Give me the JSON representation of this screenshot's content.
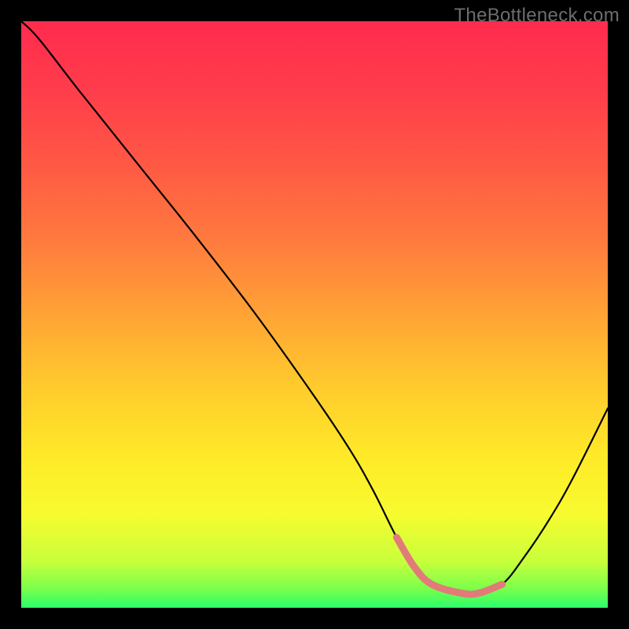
{
  "watermark": "TheBottleneck.com",
  "chart_data": {
    "type": "line",
    "title": "",
    "xlabel": "",
    "ylabel": "",
    "xlim": [
      0,
      100
    ],
    "ylim": [
      0,
      100
    ],
    "series": [
      {
        "name": "main-curve",
        "color": "#000000",
        "x": [
          0,
          3,
          10,
          20,
          30,
          40,
          50,
          56,
          60,
          64,
          67,
          70,
          75,
          78,
          82,
          86,
          90,
          94,
          100
        ],
        "y": [
          100,
          97,
          88,
          75.5,
          63,
          50,
          36,
          27,
          20,
          12,
          7,
          4,
          2.5,
          2.5,
          4,
          9,
          15,
          22,
          34
        ]
      },
      {
        "name": "trough-highlight",
        "color": "#e27a7a",
        "x": [
          64,
          67,
          70,
          75,
          78,
          82
        ],
        "y": [
          12,
          7,
          4,
          2.5,
          2.5,
          4
        ]
      }
    ],
    "background_gradient": {
      "stops": [
        {
          "offset": 0.0,
          "color": "#ff2b4e"
        },
        {
          "offset": 0.12,
          "color": "#ff3d4b"
        },
        {
          "offset": 0.25,
          "color": "#ff5a44"
        },
        {
          "offset": 0.38,
          "color": "#ff7c3e"
        },
        {
          "offset": 0.5,
          "color": "#ffa335"
        },
        {
          "offset": 0.62,
          "color": "#ffca2d"
        },
        {
          "offset": 0.74,
          "color": "#ffe928"
        },
        {
          "offset": 0.84,
          "color": "#f7fb2f"
        },
        {
          "offset": 0.92,
          "color": "#c9ff3b"
        },
        {
          "offset": 0.965,
          "color": "#7fff4a"
        },
        {
          "offset": 1.0,
          "color": "#2bff6a"
        }
      ]
    }
  }
}
